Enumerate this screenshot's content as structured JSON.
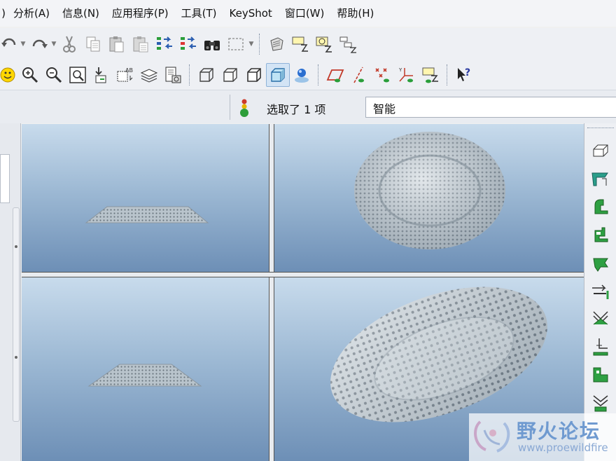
{
  "menubar": {
    "partial_leading": ")",
    "items": [
      {
        "label": "分析(A)"
      },
      {
        "label": "信息(N)"
      },
      {
        "label": "应用程序(P)"
      },
      {
        "label": "工具(T)"
      },
      {
        "label": "KeyShot"
      },
      {
        "label": "窗口(W)"
      },
      {
        "label": "帮助(H)"
      }
    ]
  },
  "selection": {
    "status_text": "选取了 1 项",
    "filter_value": "智能"
  },
  "watermark": {
    "title": "野火论坛",
    "url": "www.proewildfire"
  },
  "colors": {
    "viewport_top": "#c8dbec",
    "viewport_bottom": "#6d8fb6",
    "accent_green": "#2e9e3a",
    "icon_blue": "#2a5db0"
  },
  "icons": {
    "toolbar1": [
      "undo-icon",
      "redo-icon",
      "cut-icon",
      "copy-icon",
      "paste-icon",
      "paste-special-icon",
      "regenerate-icon",
      "regenerate-manager-icon",
      "find-icon",
      "select-box-icon",
      "spin-center-icon",
      "view-manager-icon",
      "saved-views-icon",
      "layer-tree-icon"
    ],
    "toolbar2": [
      "smiley-icon",
      "zoom-in-icon",
      "zoom-out-icon",
      "refit-icon",
      "reorient-icon",
      "annotation-icon",
      "layers-icon",
      "model-tree-icon",
      "wireframe-icon",
      "hidden-line-icon",
      "no-hidden-icon",
      "shading-icon",
      "enhanced-realism-icon",
      "plane-display-icon",
      "axis-display-icon",
      "point-display-icon",
      "csys-display-icon",
      "annotation-display-icon",
      "whats-this-icon"
    ],
    "right": [
      "extrude-icon",
      "revolve-icon",
      "sweep-icon",
      "blend-icon",
      "flange-icon",
      "rip-icon",
      "bend-icon",
      "unbend-icon",
      "form-icon",
      "punch-icon"
    ]
  }
}
